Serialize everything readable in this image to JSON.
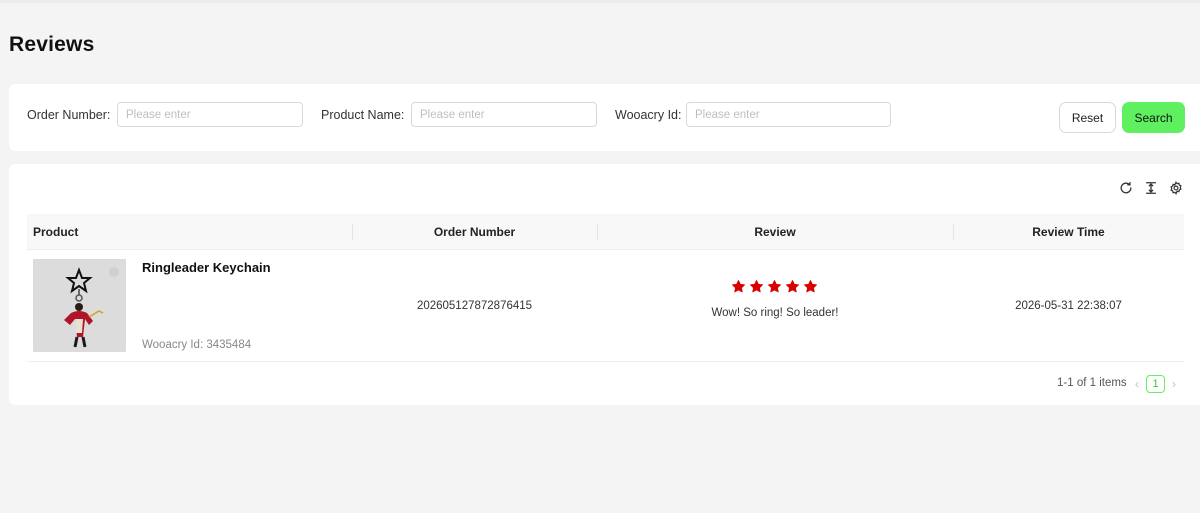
{
  "page": {
    "title": "Reviews"
  },
  "filters": {
    "order_number": {
      "label": "Order Number:",
      "placeholder": "Please enter",
      "value": ""
    },
    "product_name": {
      "label": "Product Name:",
      "placeholder": "Please enter",
      "value": ""
    },
    "wooacry_id": {
      "label": "Wooacry Id:",
      "placeholder": "Please enter",
      "value": ""
    },
    "reset_label": "Reset",
    "search_label": "Search"
  },
  "toolbar": {
    "icons": [
      "refresh-icon",
      "column-height-icon",
      "settings-icon"
    ]
  },
  "table": {
    "columns": [
      "Product",
      "Order Number",
      "Review",
      "Review Time"
    ],
    "rows": [
      {
        "product_name": "Ringleader Keychain",
        "wooacry_id": "Wooacry Id: 3435484",
        "order_number": "202605127872876415",
        "rating": 5,
        "review_text": "Wow! So ring! So leader!",
        "review_time": "2026-05-31 22:38:07"
      }
    ]
  },
  "pagination": {
    "total_text": "1-1 of 1 items",
    "current_page": "1"
  },
  "colors": {
    "accent": "#5ef05e",
    "star": "#d90000",
    "background": "#f4f4f4"
  }
}
